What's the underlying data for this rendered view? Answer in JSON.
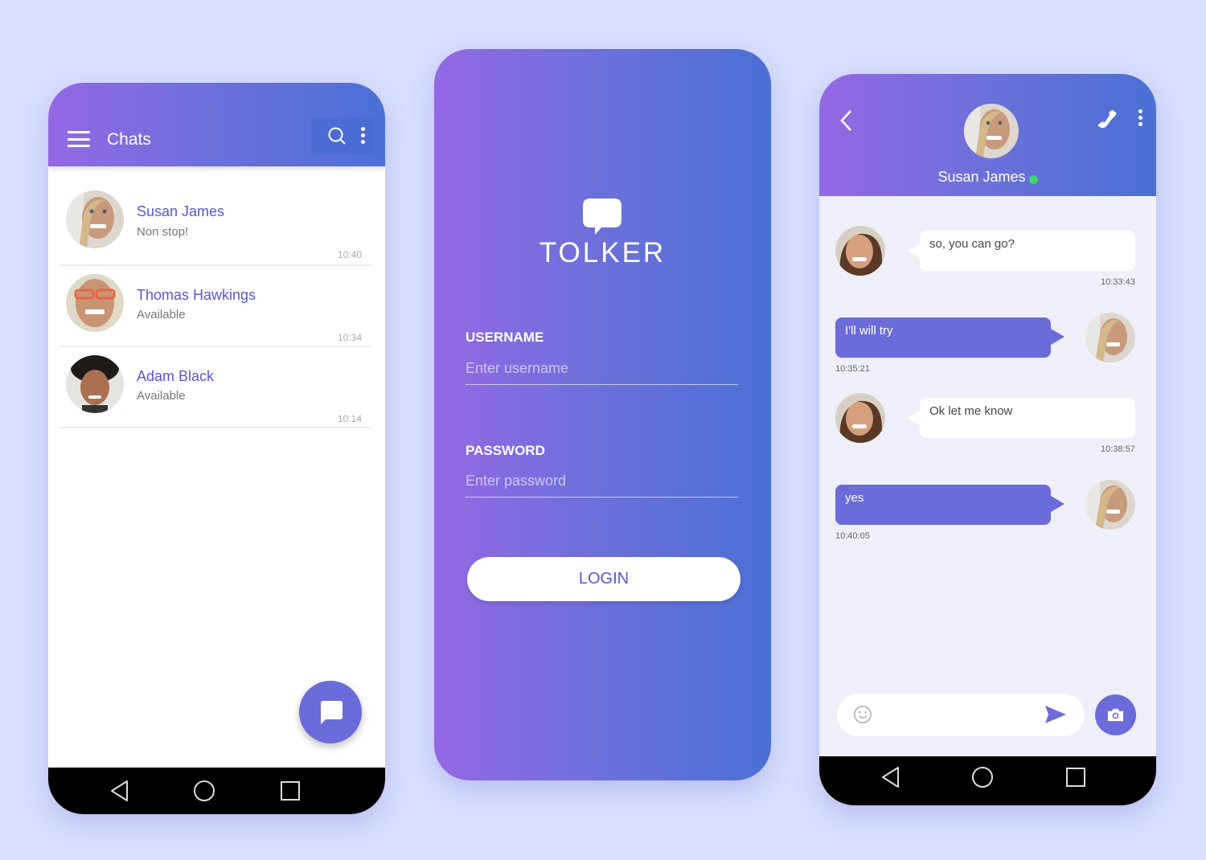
{
  "colors": {
    "background": "#d9defc",
    "gradient_start": "#9468e4",
    "gradient_end": "#4b70d4",
    "accent": "#6b6cd9",
    "name_text": "#5a55d4",
    "online": "#3dd66a"
  },
  "chats_screen": {
    "title": "Chats",
    "icons": [
      "menu-icon",
      "search-icon",
      "more-vert-icon",
      "new-chat-icon"
    ],
    "contacts": [
      {
        "name": "Susan James",
        "status": "Non stop!",
        "time": "10:40"
      },
      {
        "name": "Thomas Hawkings",
        "status": "Available",
        "time": "10:34"
      },
      {
        "name": "Adam Black",
        "status": "Available",
        "time": "10:14"
      }
    ],
    "nav": [
      "back-icon",
      "home-icon",
      "recents-icon"
    ]
  },
  "login_screen": {
    "brand": "TOLKER",
    "username_label": "USERNAME",
    "username_placeholder": "Enter username",
    "username_value": "",
    "password_label": "PASSWORD",
    "password_placeholder": "Enter password",
    "password_value": "",
    "login_label": "LOGIN"
  },
  "conversation_screen": {
    "contact_name": "Susan James",
    "online": true,
    "messages": [
      {
        "direction": "in",
        "text": "so, you can go?",
        "time": "10:33:43"
      },
      {
        "direction": "out",
        "text": "I'll will try",
        "time": "10:35:21"
      },
      {
        "direction": "in",
        "text": "Ok let me know",
        "time": "10:38:57"
      },
      {
        "direction": "out",
        "text": "yes",
        "time": "10:40:05"
      }
    ],
    "input_placeholder": "",
    "input_value": ""
  }
}
